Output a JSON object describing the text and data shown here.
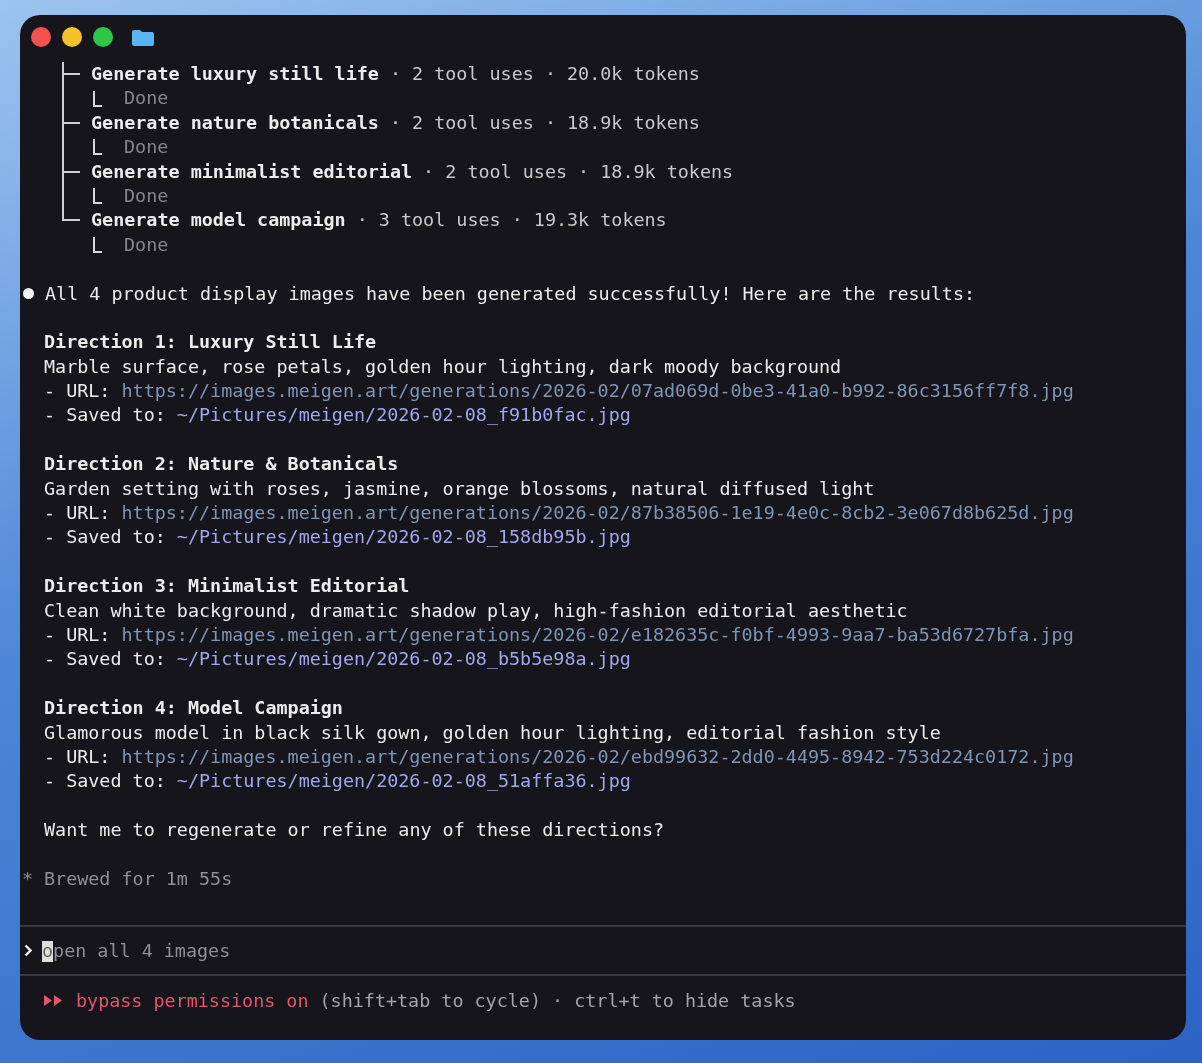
{
  "tasks": [
    {
      "name": "Generate luxury still life",
      "stats": "· 2 tool uses · 20.0k tokens",
      "status": "Done"
    },
    {
      "name": "Generate nature botanicals",
      "stats": "· 2 tool uses · 18.9k tokens",
      "status": "Done"
    },
    {
      "name": "Generate minimalist editorial",
      "stats": "· 2 tool uses · 18.9k tokens",
      "status": "Done"
    },
    {
      "name": "Generate model campaign",
      "stats": "· 3 tool uses · 19.3k tokens",
      "status": "Done"
    }
  ],
  "summary": "All 4 product display images have been generated successfully! Here are the results:",
  "directions": [
    {
      "title": "Direction 1: Luxury Still Life",
      "description": "Marble surface, rose petals, golden hour lighting, dark moody background",
      "url_label": "- URL:",
      "url": "https://images.meigen.art/generations/2026-02/07ad069d-0be3-41a0-b992-86c3156ff7f8.jpg",
      "saved_label": "- Saved to:",
      "saved_path": "~/Pictures/meigen/2026-02-08_f91b0fac.jpg"
    },
    {
      "title": "Direction 2: Nature & Botanicals",
      "description": "Garden setting with roses, jasmine, orange blossoms, natural diffused light",
      "url_label": "- URL:",
      "url": "https://images.meigen.art/generations/2026-02/87b38506-1e19-4e0c-8cb2-3e067d8b625d.jpg",
      "saved_label": "- Saved to:",
      "saved_path": "~/Pictures/meigen/2026-02-08_158db95b.jpg"
    },
    {
      "title": "Direction 3: Minimalist Editorial",
      "description": "Clean white background, dramatic shadow play, high-fashion editorial aesthetic",
      "url_label": "- URL:",
      "url": "https://images.meigen.art/generations/2026-02/e182635c-f0bf-4993-9aa7-ba53d6727bfa.jpg",
      "saved_label": "- Saved to:",
      "saved_path": "~/Pictures/meigen/2026-02-08_b5b5e98a.jpg"
    },
    {
      "title": "Direction 4: Model Campaign",
      "description": "Glamorous model in black silk gown, golden hour lighting, editorial fashion style",
      "url_label": "- URL:",
      "url": "https://images.meigen.art/generations/2026-02/ebd99632-2dd0-4495-8942-753d224c0172.jpg",
      "saved_label": "- Saved to:",
      "saved_path": "~/Pictures/meigen/2026-02-08_51affa36.jpg"
    }
  ],
  "question": "Want me to regenerate or refine any of these directions?",
  "brewed": {
    "symbol": "*",
    "text": "Brewed for 1m 55s"
  },
  "prompt": {
    "placeholder": "open all 4 images"
  },
  "status_bar": {
    "mode": "bypass permissions on",
    "hint": "(shift+tab to cycle) · ctrl+t to hide tasks"
  }
}
